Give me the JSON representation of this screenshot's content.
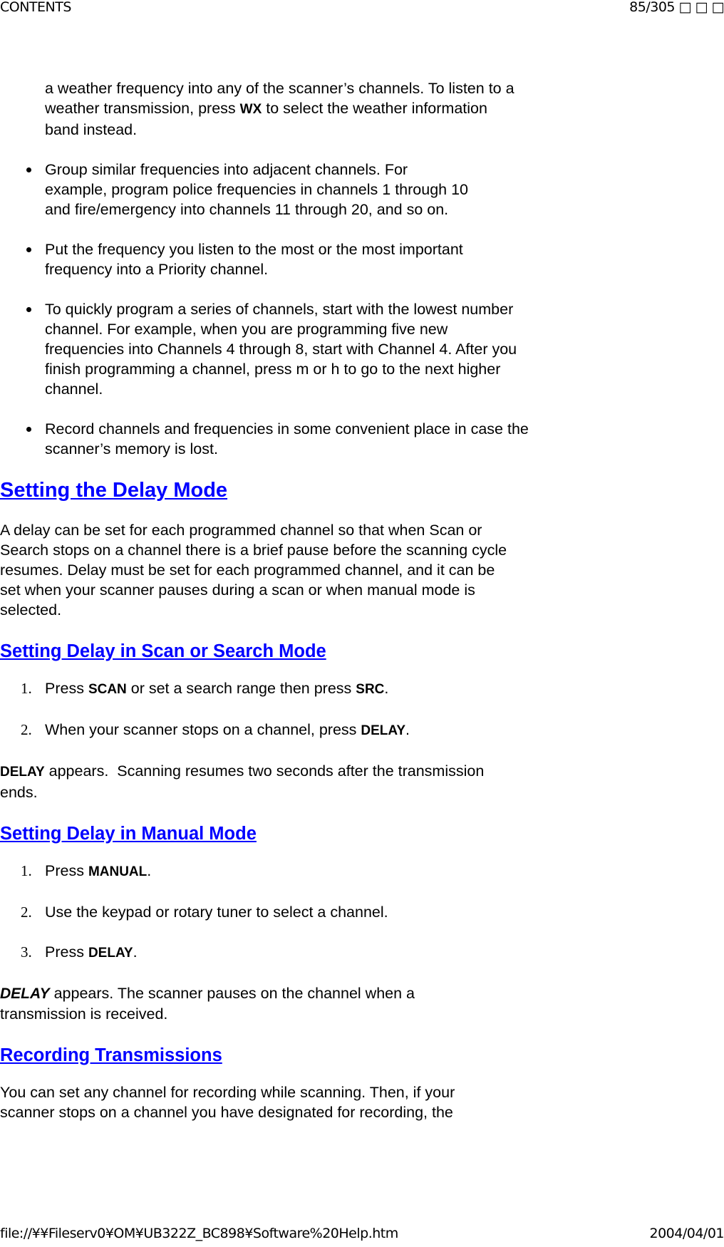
{
  "header": {
    "left": "CONTENTS",
    "right": "85/305 □ □ □"
  },
  "footer": {
    "left": "file://¥¥Fileserv0¥OM¥UB322Z_BC898¥Software%20Help.htm",
    "right": "2004/04/01"
  },
  "intro": {
    "pre": "a weather frequency into any of the scanner’s channels. To listen to a weather transmission, press ",
    "key": "WX",
    "post": " to select the weather information band instead."
  },
  "tips": [
    "Group similar frequencies into adjacent channels. For example, program police frequencies in channels 1 through 10 and fire/emergency into channels 11 through 20, and so on.",
    "Put the frequency you listen to the most or the most important frequency into a Priority channel.",
    "To quickly program a series of channels, start with the lowest number channel. For example, when you are programming five new frequencies into Channels 4 through 8, start with Channel 4. After you finish programming a channel, press m or h to go to the next higher channel.",
    "Record channels and frequencies in some convenient place in case the scanner’s memory is lost."
  ],
  "delay_section": {
    "title": "Setting the Delay Mode",
    "body": "A delay can be set for each programmed channel so that when Scan or Search stops on a channel there is a brief pause before the scanning cycle resumes. Delay must be set for each programmed channel, and it can be set when your scanner pauses during a scan or when manual mode is selected."
  },
  "scan_section": {
    "title": "Setting Delay in Scan or Search Mode",
    "steps": [
      {
        "num": "1.",
        "pre": "Press ",
        "key1": "SCAN",
        "mid": " or set a search range then press ",
        "key2": "SRC",
        "post": "."
      },
      {
        "num": "2.",
        "pre": "When your scanner stops on a channel, press ",
        "key1": "DELAY",
        "post": "."
      }
    ],
    "result_key": "DELAY",
    "result_text": " appears.  Scanning resumes two seconds after the transmission ends."
  },
  "manual_section": {
    "title": "Setting Delay in Manual Mode",
    "steps": [
      {
        "num": "1.",
        "pre": "Press ",
        "key1": "MANUAL",
        "post": "."
      },
      {
        "num": "2.",
        "text": "Use the keypad or rotary tuner to select a channel."
      },
      {
        "num": "3.",
        "pre": "Press ",
        "key1": "DELAY",
        "post": "."
      }
    ],
    "result_key": "DELAY",
    "result_text": " appears. The scanner pauses on the channel when a transmission is received."
  },
  "recording_section": {
    "title": "Recording Transmissions",
    "body": "You can set any channel for recording while scanning. Then, if your scanner stops on a channel you have designated for recording, the"
  }
}
